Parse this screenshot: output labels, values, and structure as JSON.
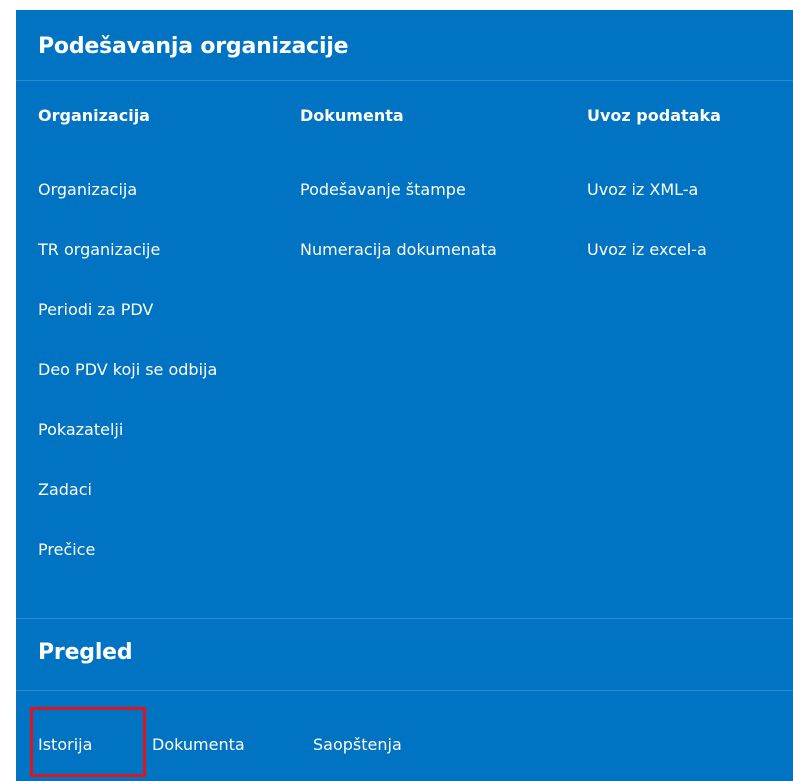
{
  "settings": {
    "title": "Podešavanja organizacije",
    "columns": [
      {
        "heading": "Organizacija",
        "items": [
          "Organizacija",
          "TR organizacije",
          "Periodi za PDV",
          "Deo PDV koji se odbija",
          "Pokazatelji",
          "Zadaci",
          "Prečice"
        ]
      },
      {
        "heading": "Dokumenta",
        "items": [
          "Podešavanje štampe",
          "Numeracija dokumenata"
        ]
      },
      {
        "heading": "Uvoz podataka",
        "items": [
          "Uvoz iz XML-a",
          "Uvoz iz excel-a"
        ]
      }
    ]
  },
  "overview": {
    "title": "Pregled",
    "tabs": [
      "Istorija",
      "Dokumenta",
      "Saopštenja"
    ],
    "highlighted_tab": "Istorija"
  },
  "colors": {
    "panel_bg": "#0073c2",
    "divider": "#2a8bd0",
    "text": "#ffffff",
    "highlight_border": "#e0141f"
  }
}
